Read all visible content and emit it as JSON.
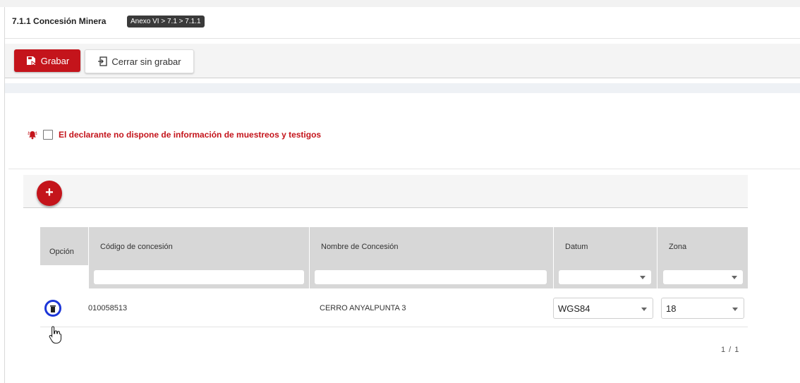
{
  "header": {
    "title": "7.1.1 Concesión Minera",
    "breadcrumb": "Anexo VI > 7.1 > 7.1.1"
  },
  "toolbar": {
    "save_label": "Grabar",
    "close_label": "Cerrar sin grabar"
  },
  "notice": {
    "checkbox_checked": false,
    "text": "El declarante no dispone de información de muestreos y testigos"
  },
  "add_button": {
    "label": "+"
  },
  "table": {
    "columns": [
      "Opción",
      "Código de concesión",
      "Nombre de Concesión",
      "Datum",
      "Zona"
    ],
    "filters": {
      "codigo": "",
      "nombre": "",
      "datum": "",
      "zona": ""
    },
    "rows": [
      {
        "codigo": "010058513",
        "nombre": "CERRO ANYALPUNTA 3",
        "datum": "WGS84",
        "zona": "18"
      }
    ]
  },
  "pager": {
    "text": "1 / 1"
  },
  "colors": {
    "accent": "#c4141b",
    "focus": "#1c36d8"
  },
  "icons": [
    "save-icon",
    "exit-icon",
    "alarm-icon",
    "plus-icon",
    "trash-icon",
    "hand-cursor-icon",
    "chevron-down-icon"
  ]
}
